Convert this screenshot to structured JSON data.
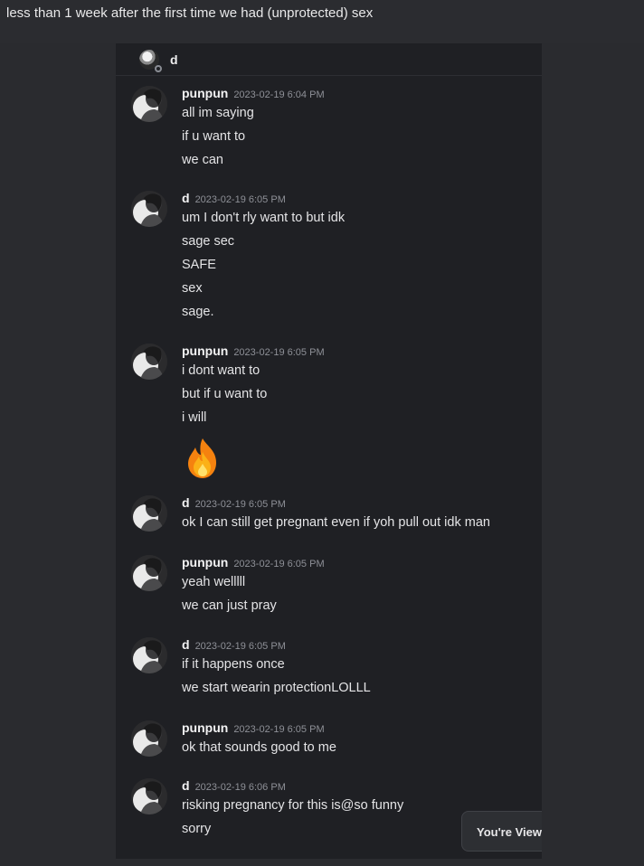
{
  "caption": "less than 1 week after the first time we had (unprotected) sex",
  "header": {
    "name": "d"
  },
  "messages": [
    {
      "author": "punpun",
      "timestamp": "2023-02-19 6:04 PM",
      "lines": [
        "all im saying",
        "if u want to",
        "we can"
      ]
    },
    {
      "author": "d",
      "timestamp": "2023-02-19 6:05 PM",
      "lines": [
        "um I don't rly want to but idk",
        "sage sec",
        "SAFE",
        "sex",
        "sage."
      ]
    },
    {
      "author": "punpun",
      "timestamp": "2023-02-19 6:05 PM",
      "lines": [
        "i dont want to",
        "but if u want to",
        "i will"
      ],
      "emoji": "fire-emoji"
    },
    {
      "author": "d",
      "timestamp": "2023-02-19 6:05 PM",
      "lines": [
        "ok I can still get pregnant even if yoh pull out idk man"
      ]
    },
    {
      "author": "punpun",
      "timestamp": "2023-02-19 6:05 PM",
      "lines": [
        "yeah welllll",
        "we can just pray"
      ]
    },
    {
      "author": "d",
      "timestamp": "2023-02-19 6:05 PM",
      "lines": [
        "if it happens once",
        "we start wearin protectionLOLLL"
      ]
    },
    {
      "author": "punpun",
      "timestamp": "2023-02-19 6:05 PM",
      "lines": [
        "ok that sounds good to me"
      ]
    },
    {
      "author": "d",
      "timestamp": "2023-02-19 6:06 PM",
      "lines": [
        "risking pregnancy for this is@so funny",
        "sorry"
      ]
    }
  ],
  "toast": {
    "label": "You're Viewi"
  },
  "colors": {
    "page_bg": "#2a2b2f",
    "chat_bg": "#1f2024",
    "timestamp": "#8e9097"
  }
}
